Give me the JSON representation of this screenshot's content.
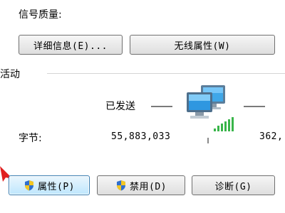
{
  "connection": {
    "signal_quality_label": "信号质量:"
  },
  "buttons": {
    "details_label": "详细信息(E)...",
    "wireless_props_label": "无线属性(W)",
    "properties_label": "属性(P)",
    "disable_label": "禁用(D)",
    "diagnose_label": "诊断(G)"
  },
  "activity": {
    "section_title": "活动",
    "sent_label": "已发送",
    "bytes_label": "字节:",
    "sent_bytes": "55,883,033",
    "received_bytes_partial": "362,"
  },
  "icons": {
    "network": "network-computers-icon",
    "signal": "signal-strength-icon",
    "shield": "uac-shield-icon",
    "pointer": "red-arrow-pointer"
  },
  "colors": {
    "signal_green": "#39b54a",
    "focus_blue": "#3c7fb1",
    "arrow_red": "#e02020"
  }
}
